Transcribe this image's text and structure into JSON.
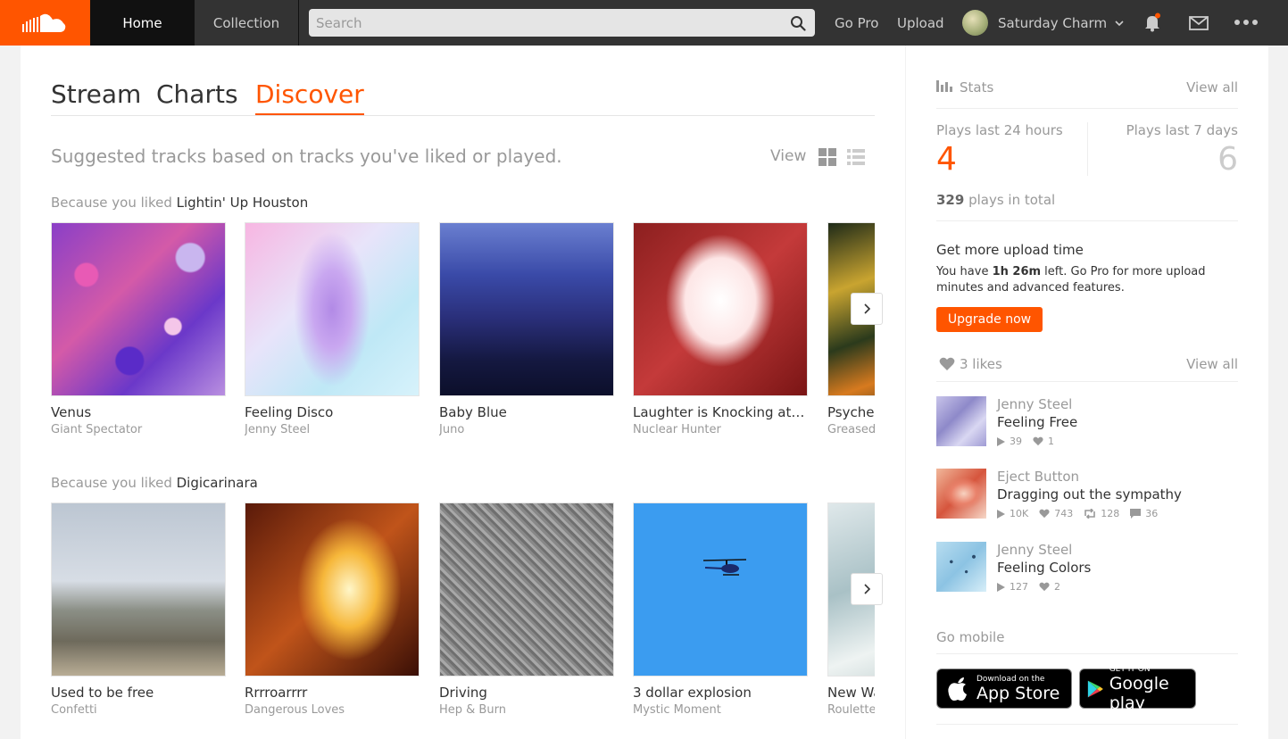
{
  "header": {
    "logo_icon": "soundcloud-logo-icon",
    "nav": {
      "home": "Home",
      "collection": "Collection"
    },
    "search": {
      "placeholder": "Search"
    },
    "go_pro": "Go Pro",
    "upload": "Upload",
    "user_name": "Saturday Charm",
    "icons": [
      "search-icon",
      "notifications-bell-icon",
      "messages-envelope-icon",
      "more-dots-icon"
    ],
    "accent_color": "#ff5500"
  },
  "tabs": [
    "Stream",
    "Charts",
    "Discover"
  ],
  "active_tab": "Discover",
  "subtitle": "Suggested tracks based on tracks you've liked or played.",
  "view_label": "View",
  "sections": [
    {
      "prefix": "Because you liked",
      "liked": "Lightin' Up Houston",
      "tracks": [
        {
          "title": "Venus",
          "artist": "Giant Spectator"
        },
        {
          "title": "Feeling Disco",
          "artist": "Jenny Steel"
        },
        {
          "title": "Baby Blue",
          "artist": "Juno"
        },
        {
          "title": "Laughter is Knocking at M...",
          "artist": "Nuclear Hunter"
        },
        {
          "title": "Psyched",
          "artist": "Greased"
        }
      ]
    },
    {
      "prefix": "Because you liked",
      "liked": "Digicarinara",
      "tracks": [
        {
          "title": "Used to be free",
          "artist": "Confetti"
        },
        {
          "title": "Rrrroarrrr",
          "artist": "Dangerous Loves"
        },
        {
          "title": "Driving",
          "artist": "Hep & Burn"
        },
        {
          "title": "3 dollar explosion",
          "artist": "Mystic Moment"
        },
        {
          "title": "New Wa",
          "artist": "Roulette"
        }
      ]
    }
  ],
  "sidebar": {
    "stats": {
      "title": "Stats",
      "view_all": "View all",
      "plays_24h_label": "Plays last 24 hours",
      "plays_24h": "4",
      "plays_7d_label": "Plays last 7 days",
      "plays_7d": "6",
      "total_count": "329",
      "total_suffix": "plays in total"
    },
    "upsell": {
      "title": "Get more upload time",
      "text_prefix": "You have ",
      "time_left": "1h 26m",
      "text_suffix": " left. Go Pro for more upload minutes and advanced features.",
      "button": "Upgrade now"
    },
    "likes": {
      "title": "3 likes",
      "view_all": "View all",
      "items": [
        {
          "artist": "Jenny Steel",
          "title": "Feeling Free",
          "plays": "39",
          "likes": "1"
        },
        {
          "artist": "Eject Button",
          "title": "Dragging out the sympathy",
          "plays": "10K",
          "likes": "743",
          "reposts": "128",
          "comments": "36"
        },
        {
          "artist": "Jenny Steel",
          "title": "Feeling Colors",
          "plays": "127",
          "likes": "2"
        }
      ]
    },
    "mobile": {
      "title": "Go mobile",
      "app_store_small": "Download on the",
      "app_store_big": "App Store",
      "google_small": "GET IT ON",
      "google_big": "Google play"
    }
  }
}
